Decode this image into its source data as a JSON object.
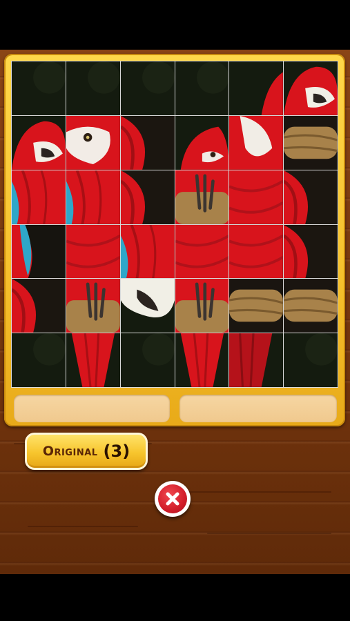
{
  "puzzle": {
    "grid": {
      "rows": 6,
      "cols": 6
    },
    "tiles": [
      {
        "id": "r1c1",
        "content": "dark-background"
      },
      {
        "id": "r1c2",
        "content": "dark-background"
      },
      {
        "id": "r1c3",
        "content": "dark-background"
      },
      {
        "id": "r1c4",
        "content": "dark-background"
      },
      {
        "id": "r1c5",
        "content": "parrot-crest-edge"
      },
      {
        "id": "r1c6",
        "content": "parrot-head-beak"
      },
      {
        "id": "r2c1",
        "content": "parrot-head-beak"
      },
      {
        "id": "r2c2",
        "content": "parrot-face-eye"
      },
      {
        "id": "r2c3",
        "content": "red-feathers-dark"
      },
      {
        "id": "r2c4",
        "content": "parrot-crest"
      },
      {
        "id": "r2c5",
        "content": "parrot-face-white"
      },
      {
        "id": "r2c6",
        "content": "branch"
      },
      {
        "id": "r3c1",
        "content": "red-blue-wing"
      },
      {
        "id": "r3c2",
        "content": "red-blue-wing"
      },
      {
        "id": "r3c3",
        "content": "red-feathers-dark"
      },
      {
        "id": "r3c4",
        "content": "branch-claw"
      },
      {
        "id": "r3c5",
        "content": "red-body"
      },
      {
        "id": "r3c6",
        "content": "red-feathers-dark"
      },
      {
        "id": "r4c1",
        "content": "blue-wing-dark"
      },
      {
        "id": "r4c2",
        "content": "red-body"
      },
      {
        "id": "r4c3",
        "content": "red-blue-wing"
      },
      {
        "id": "r4c4",
        "content": "red-body"
      },
      {
        "id": "r4c5",
        "content": "red-body"
      },
      {
        "id": "r4c6",
        "content": "red-feathers-dark"
      },
      {
        "id": "r5c1",
        "content": "red-feathers-dark"
      },
      {
        "id": "r5c2",
        "content": "branch-claw"
      },
      {
        "id": "r5c3",
        "content": "beak-dark"
      },
      {
        "id": "r5c4",
        "content": "branch-claw"
      },
      {
        "id": "r5c5",
        "content": "branch"
      },
      {
        "id": "r5c6",
        "content": "branch"
      },
      {
        "id": "r6c1",
        "content": "dark-background"
      },
      {
        "id": "r6c2",
        "content": "red-tail"
      },
      {
        "id": "r6c3",
        "content": "dark-background"
      },
      {
        "id": "r6c4",
        "content": "red-tail"
      },
      {
        "id": "r6c5",
        "content": "red-tail-dark"
      },
      {
        "id": "r6c6",
        "content": "dark-background"
      }
    ]
  },
  "trays": {
    "left": "",
    "right": ""
  },
  "original_button": {
    "label": "Original",
    "count": "(3)"
  },
  "close_button": {
    "icon": "close-icon"
  },
  "colors": {
    "frame": "#f6c02c",
    "wood": "#7a3a10",
    "parrot_red": "#d8141c",
    "parrot_blue": "#2fa7c9",
    "branch": "#a8824a",
    "close_red": "#d21d2a"
  }
}
